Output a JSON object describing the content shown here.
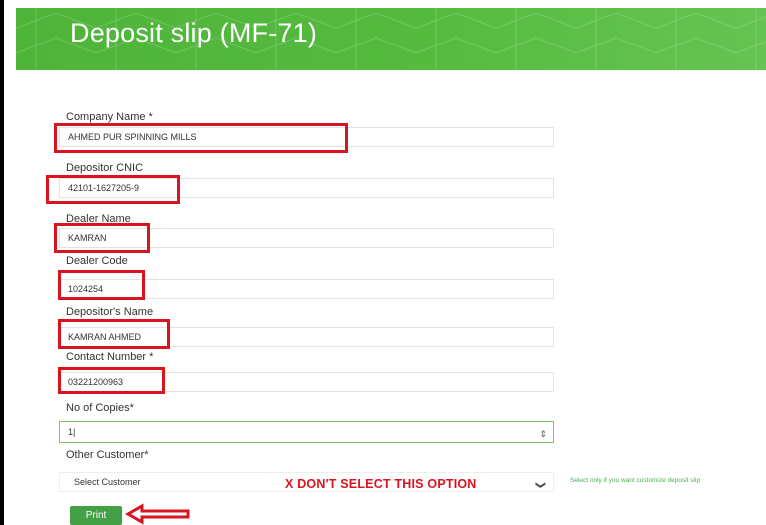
{
  "header": {
    "title": "Deposit slip (MF-71)"
  },
  "form": {
    "company_name": {
      "label": "Company Name *",
      "value": "AHMED PUR SPINNING MILLS"
    },
    "depositor_cnic": {
      "label": "Depositor CNIC",
      "value": "42101-1627205-9"
    },
    "dealer_name": {
      "label": "Dealer Name",
      "value": "KAMRAN"
    },
    "dealer_code": {
      "label": "Dealer Code",
      "value": "1024254"
    },
    "depositor_name": {
      "label": "Depositor's Name",
      "value": "KAMRAN AHMED"
    },
    "contact_number": {
      "label": "Contact Number *",
      "value": "03221200963"
    },
    "copies": {
      "label": "No of Copies*",
      "value": "1"
    },
    "other_customer": {
      "label": "Other Customer*",
      "selected": "Select Customer",
      "hint": "Select only if you want customize deposit slip"
    },
    "print_label": "Print"
  },
  "annotations": {
    "warning": "X DON'T SELECT THIS OPTION",
    "highlight_color": "#d7141f"
  },
  "colors": {
    "brand_green": "#55bb3f",
    "button_green": "#43a047"
  }
}
